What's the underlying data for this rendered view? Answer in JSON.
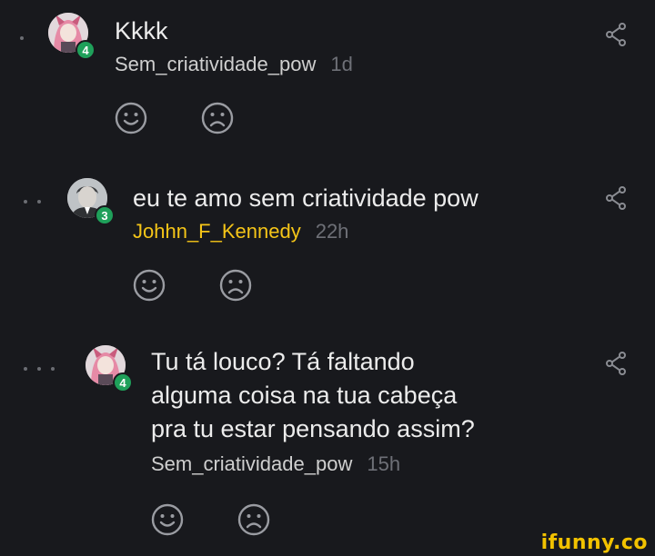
{
  "comments": [
    {
      "text_lines": [
        "Kkkk"
      ],
      "username": "Sem_criatividade_pow",
      "time": "1d",
      "level": "4",
      "avatar_icon": "anime-avatar-icon"
    },
    {
      "text_lines": [
        "eu te amo sem criatividade pow"
      ],
      "username": "Johhn_F_Kennedy",
      "time": "22h",
      "level": "3",
      "avatar_icon": "portrait-avatar-icon"
    },
    {
      "text_lines": [
        "Tu tá louco? Tá faltando",
        "alguma coisa na tua cabeça",
        "pra tu estar pensando assim?"
      ],
      "username": "Sem_criatividade_pow",
      "time": "15h",
      "level": "4",
      "avatar_icon": "anime-avatar-icon"
    }
  ],
  "watermark": "ifunny.co",
  "colors": {
    "background": "#18191d",
    "text": "#ececec",
    "username_highlight": "#f5c518",
    "level_badge": "#1fa05a",
    "meta_gray": "#6e7077",
    "watermark": "#f2c200"
  }
}
